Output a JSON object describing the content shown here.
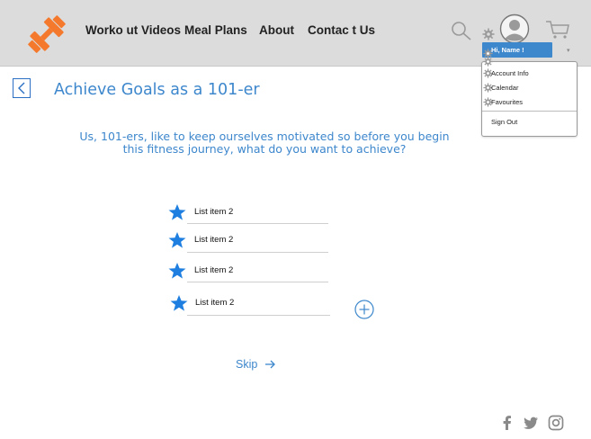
{
  "nav": {
    "links": [
      "Worko ut Videos",
      "Meal Plans",
      "About",
      "Contac t Us"
    ]
  },
  "user": {
    "greeting": "Hi, Name !",
    "menu": [
      "Account Info",
      "Calendar",
      "Favourites"
    ],
    "sign_out": "Sign Out"
  },
  "page": {
    "title": "Achieve Goals as a 101-er",
    "intro": "Us, 101-ers, like to keep ourselves motivated so before you begin this fitness journey, what do you want to achieve?"
  },
  "goals": [
    "List item 2",
    "List item 2",
    "List item 2",
    "List item 2"
  ],
  "skip_label": "Skip",
  "colors": {
    "accent": "#3d87cc",
    "star": "#1f7fe0",
    "logo": "#f4792c",
    "header_bg": "#dcdcdc"
  },
  "icons": {
    "logo": "dumbbell-icon",
    "search": "search-icon",
    "settings": "gear-icon",
    "avatar": "user-avatar-icon",
    "cart": "cart-icon",
    "back": "chevron-left-icon",
    "goal": "star-icon",
    "add": "plus-circle-icon",
    "skip": "arrow-right-icon",
    "social": [
      "facebook-icon",
      "twitter-icon",
      "instagram-icon"
    ]
  }
}
